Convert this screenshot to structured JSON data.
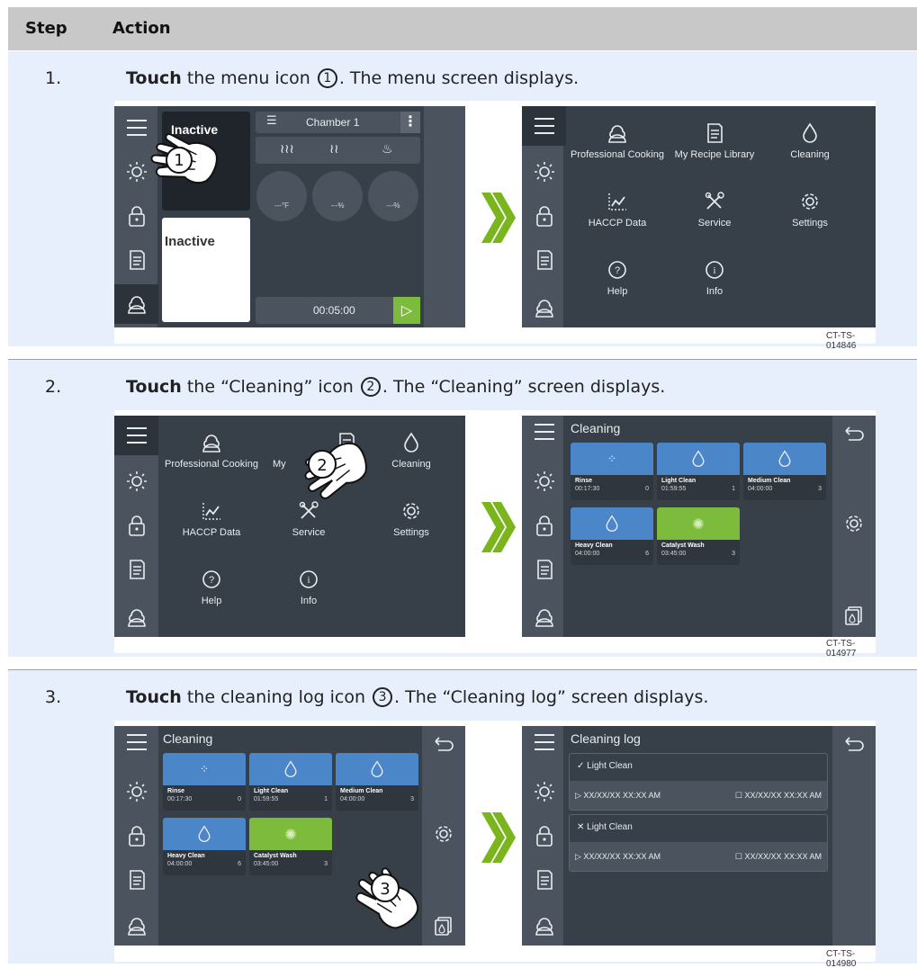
{
  "table": {
    "header_step": "Step",
    "header_action": "Action"
  },
  "steps": [
    {
      "number": "1.",
      "verb": "Touch",
      "text_a": " the menu icon ",
      "callout": "1",
      "text_b": ". The menu screen displays.",
      "figure_code": "CT-TS-014846"
    },
    {
      "number": "2.",
      "verb": "Touch",
      "text_a": " the “Cleaning” icon ",
      "callout": "2",
      "text_b": ". The “Cleaning” screen displays.",
      "figure_code": "CT-TS-014977"
    },
    {
      "number": "3.",
      "verb": "Touch",
      "text_a": " the cleaning log icon ",
      "callout": "3",
      "text_b": ". The “Cleaning log” screen displays.",
      "figure_code": "CT-TS-014980"
    }
  ],
  "home_screen": {
    "chamber": "Chamber 1",
    "status_top": "Inactive",
    "status_bottom": "Inactive",
    "temp": "---°F",
    "fan": "---%",
    "humidity": "---%",
    "timer": "00:05:00"
  },
  "menu_screen": {
    "items": [
      "Professional Cooking",
      "My Recipe Library",
      "Cleaning",
      "HACCP Data",
      "Service",
      "Settings",
      "Help",
      "Info"
    ],
    "partial_label": "My"
  },
  "cleaning_screen": {
    "title": "Cleaning",
    "programs": [
      {
        "name": "Rinse",
        "time": "00:17:30",
        "count": "0"
      },
      {
        "name": "Light Clean",
        "time": "01:59:55",
        "count": "1"
      },
      {
        "name": "Medium Clean",
        "time": "04:00:00",
        "count": "3"
      },
      {
        "name": "Heavy Clean",
        "time": "04:00:00",
        "count": "6"
      },
      {
        "name": "Catalyst Wash",
        "time": "03:45:00",
        "count": "3"
      }
    ]
  },
  "cleaning_log_screen": {
    "title": "Cleaning log",
    "entries": [
      {
        "name": "Light Clean",
        "status": "check",
        "start": "XX/XX/XX XX:XX AM",
        "end": "XX/XX/XX XX:XX AM"
      },
      {
        "name": "Light Clean",
        "status": "cross",
        "start": "XX/XX/XX XX:XX AM",
        "end": "XX/XX/XX XX:XX AM"
      }
    ]
  },
  "colors": {
    "screen_bg": "#373f48",
    "sidebar": "#4b545e",
    "tile_blue": "#4a86c8",
    "tile_green": "#7dbb3c",
    "arrow_green": "#7ab51d",
    "row_bg": "#e6effb",
    "header_bg": "#c8c8c8"
  }
}
